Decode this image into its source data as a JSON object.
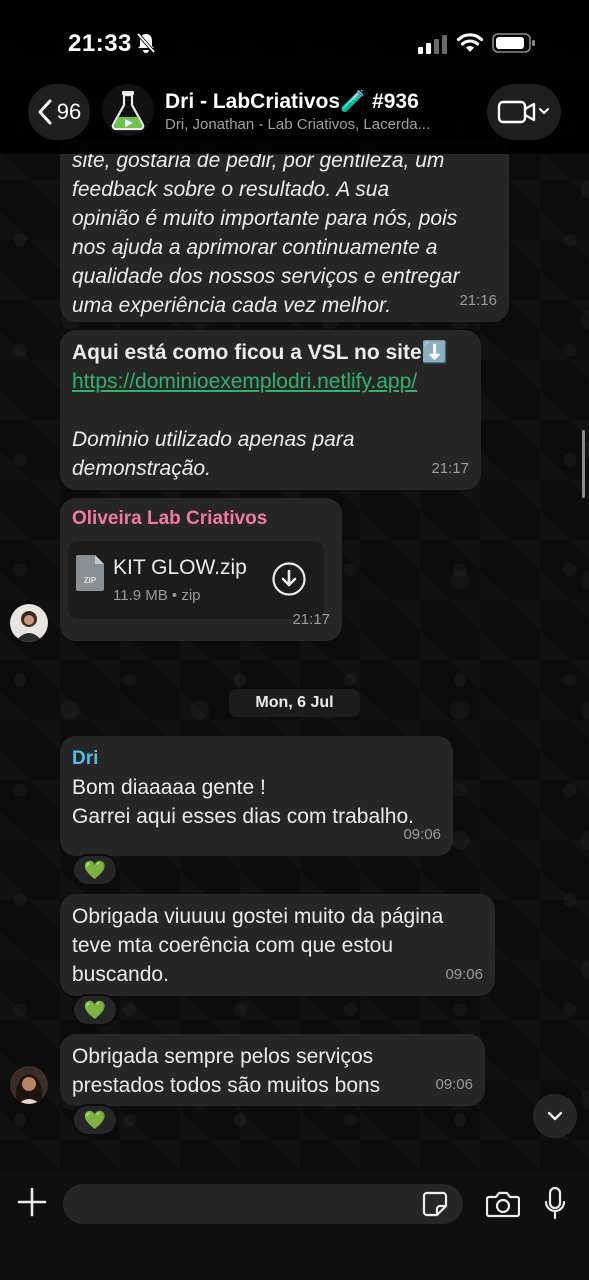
{
  "status_bar": {
    "time": "21:33"
  },
  "header": {
    "back_count": "96",
    "title": "Dri - LabCriativos",
    "title_emoji": "🧪",
    "title_suffix": " #936",
    "subtitle": "Dri, Jonathan - Lab Criativos, Lacerda..."
  },
  "messages": {
    "m1": {
      "lines": [
        "site, gostaria de pedir, por gentileza, um",
        "feedback sobre o resultado. A sua",
        "opinião é muito importante para nós, pois",
        "nos ajuda a aprimorar continuamente a",
        "qualidade dos nossos serviços e entregar",
        "uma experiência cada vez melhor."
      ],
      "time": "21:16"
    },
    "m2": {
      "heading": "Aqui está como ficou a VSL no site⬇️",
      "link": "https://dominioexemplodri.netlify.app/",
      "note_line1": "Dominio utilizado apenas para",
      "note_line2": "demonstração.",
      "time": "21:17"
    },
    "m3": {
      "sender": "Oliveira Lab Criativos",
      "file_name": "KIT GLOW.zip",
      "file_meta": "11.9 MB • zip",
      "file_type": "ZIP",
      "time": "21:17"
    },
    "date_separator": "Mon, 6 Jul",
    "m4": {
      "sender": "Dri",
      "line1": "Bom diaaaaa gente !",
      "line2": "Garrei aqui esses dias com trabalho.",
      "time": "09:06",
      "reaction": "💚"
    },
    "m5": {
      "line1": "Obrigada viuuuu gostei muito da página",
      "line2": "teve mta coerência com que estou",
      "line3": "buscando.",
      "time": "09:06",
      "reaction": "💚"
    },
    "m6": {
      "line1": "Obrigada sempre pelos serviços",
      "line2": "prestados todos são muitos bons",
      "time": "09:06",
      "reaction": "💚"
    }
  },
  "input": {
    "placeholder": ""
  },
  "colors": {
    "accent_green": "#2fb36a",
    "sender_pink": "#f07aa4",
    "sender_blue": "#53bdeb"
  }
}
